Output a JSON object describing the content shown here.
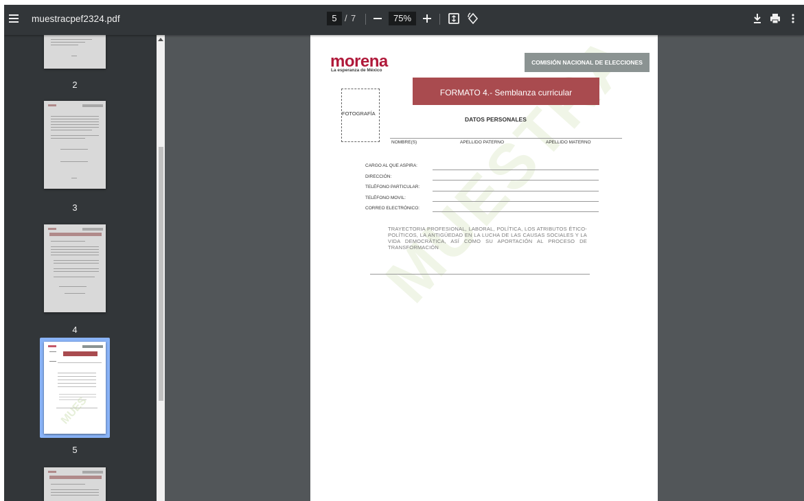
{
  "toolbar": {
    "title": "muestracpef2324.pdf",
    "current_page": "5",
    "page_separator": "/",
    "total_pages": "7",
    "zoom": "75%"
  },
  "thumbnails": [
    {
      "label": "2"
    },
    {
      "label": "3"
    },
    {
      "label": "4"
    },
    {
      "label": "5",
      "selected": true
    },
    {
      "label": ""
    }
  ],
  "document": {
    "logo": "morena",
    "logo_sub": "La esperanza de México",
    "commission": "COMISIÓN NACIONAL DE ELECCIONES",
    "form_title": "FORMATO 4.- Semblanza curricular",
    "section_title": "DATOS PERSONALES",
    "photo_label": "FOTOGRAFÍA",
    "name_labels": [
      "NOMBRE(S)",
      "APELLIDO PATERNO",
      "APELLIDO MATERNO"
    ],
    "fields": [
      "CARGO AL QUE ASPIRA:",
      "DIRECCIÓN:",
      "TELÉFONO PARTICULAR:",
      "TELÉFONO MOVIL:",
      "CORREO ELECTRÓNICO:"
    ],
    "trajectory_text": "TRAYECTORIA PROFESIONAL, LABORAL, POLÍTICA, LOS ATRIBUTOS ÉTICO-POLÍTICOS, LA ANTIGÜEDAD EN LA LUCHA DE LAS CAUSAS SOCIALES Y LA VIDA DEMOCRÁTICA, ASÍ COMO SU APORTACIÓN AL PROCESO DE TRANSFORMACIÓN",
    "watermark": "MUESTRA"
  },
  "colors": {
    "toolbar_bg": "#323639",
    "viewer_bg": "#525659",
    "selection": "#8ab4f8",
    "brand_red": "#b0193a",
    "form_banner": "#a94b4f"
  }
}
